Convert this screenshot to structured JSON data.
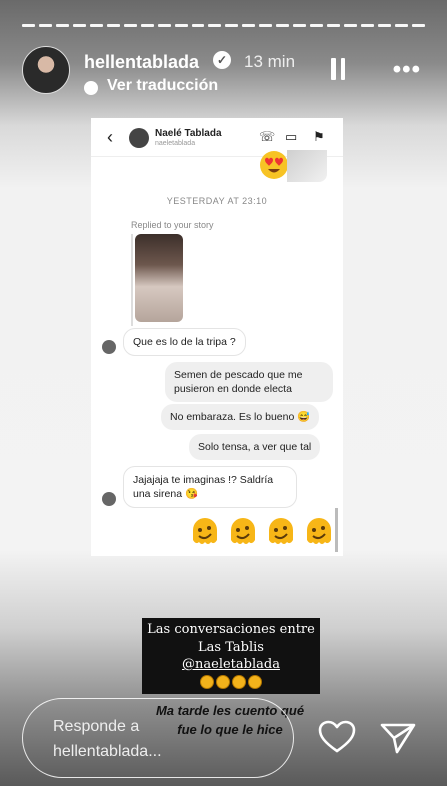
{
  "header": {
    "username": "hellentablada",
    "time_ago": "13 min",
    "translate_label": "Ver traducción"
  },
  "chat": {
    "name": "Naelé Tablada",
    "handle": "naeletablada",
    "day_label": "YESTERDAY AT 23:10",
    "replied_label": "Replied to your story",
    "messages": [
      {
        "dir": "in",
        "text": "Que es lo de la tripa ?"
      },
      {
        "dir": "out",
        "text": "Semen de pescado  que me pusieron en donde electa"
      },
      {
        "dir": "out",
        "text": "No embaraza. Es lo bueno 😅"
      },
      {
        "dir": "out",
        "text": "Solo tensa, a ver que tal"
      },
      {
        "dir": "in",
        "text": "Jajajaja te imaginas !? Saldría una sirena 😘"
      }
    ]
  },
  "caption": {
    "line1": "Las conversaciones entre",
    "line2": "Las Tablis",
    "mention": "@naeletablada",
    "italic_line1": "Ma tarde les cuento qué",
    "italic_line2": "fue lo que le hice"
  },
  "reply": {
    "line1": "Responde a",
    "line2": "hellentablada..."
  },
  "icons": {
    "verified": "verified-badge-icon",
    "pause": "pause-icon",
    "more": "more-options-icon",
    "heart": "heart-icon",
    "send": "send-icon"
  }
}
